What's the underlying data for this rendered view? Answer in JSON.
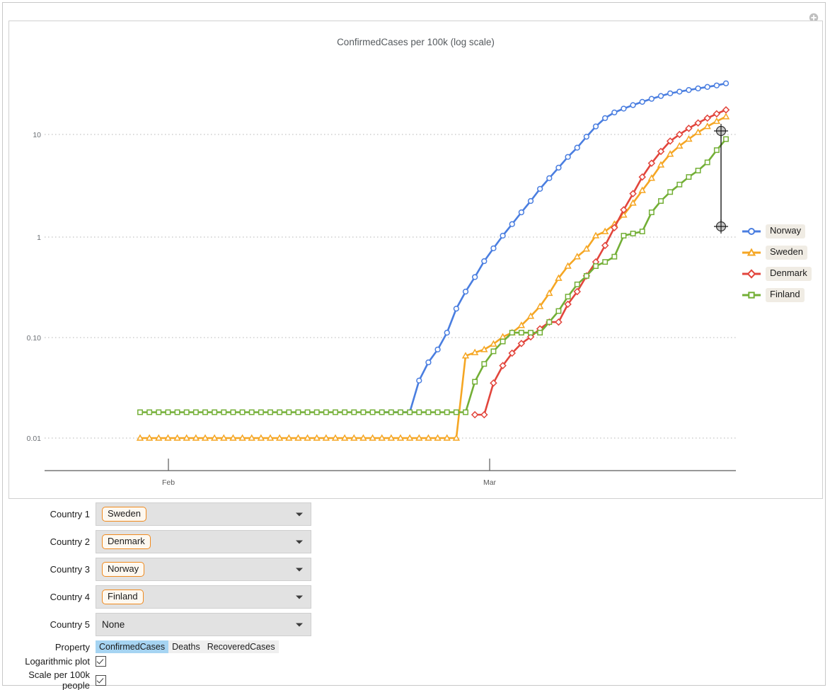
{
  "window": {
    "add_icon": "add-circle-icon"
  },
  "chart": {
    "title": "ConfirmedCases per 100k (log scale)",
    "legend": [
      {
        "label": "Norway",
        "color": "#4a7ee0",
        "marker": "circle"
      },
      {
        "label": "Sweden",
        "color": "#f5a623",
        "marker": "triangle"
      },
      {
        "label": "Denmark",
        "color": "#e2453c",
        "marker": "diamond"
      },
      {
        "label": "Finland",
        "color": "#73af36",
        "marker": "square"
      }
    ]
  },
  "chart_data": {
    "type": "line",
    "title": "ConfirmedCases per 100k (log scale)",
    "xlabel": "",
    "ylabel": "ConfirmedCases per 100k",
    "log_y": true,
    "grid": true,
    "legend_position": "right",
    "ytick_labels": [
      "10",
      "1",
      "0.10",
      "0.01"
    ],
    "ytick_values": [
      10,
      1,
      0.1,
      0.01
    ],
    "ylim": [
      0.008,
      40
    ],
    "xtick_labels": [
      "Feb",
      "Mar"
    ],
    "x": [
      "Jan 22",
      "Jan 23",
      "Jan 24",
      "Jan 25",
      "Jan 26",
      "Jan 27",
      "Jan 28",
      "Jan 29",
      "Jan 30",
      "Jan 31",
      "Feb 01",
      "Feb 02",
      "Feb 03",
      "Feb 04",
      "Feb 05",
      "Feb 06",
      "Feb 07",
      "Feb 08",
      "Feb 09",
      "Feb 10",
      "Feb 11",
      "Feb 12",
      "Feb 13",
      "Feb 14",
      "Feb 15",
      "Feb 16",
      "Feb 17",
      "Feb 18",
      "Feb 19",
      "Feb 20",
      "Feb 21",
      "Feb 22",
      "Feb 23",
      "Feb 24",
      "Feb 25",
      "Feb 26",
      "Feb 27",
      "Feb 28",
      "Feb 29",
      "Mar 01",
      "Mar 02",
      "Mar 03",
      "Mar 04",
      "Mar 05",
      "Mar 06",
      "Mar 07",
      "Mar 08",
      "Mar 09",
      "Mar 10",
      "Mar 11",
      "Mar 12",
      "Mar 13",
      "Mar 14",
      "Mar 15",
      "Mar 16",
      "Mar 17",
      "Mar 18",
      "Mar 19",
      "Mar 20",
      "Mar 21",
      "Mar 22",
      "Mar 23",
      "Mar 24",
      "Mar 25"
    ],
    "series": [
      {
        "name": "Norway",
        "color": "#4a7ee0",
        "marker": "circle",
        "values": [
          null,
          null,
          null,
          null,
          null,
          null,
          null,
          null,
          null,
          null,
          null,
          null,
          null,
          null,
          null,
          null,
          null,
          null,
          null,
          null,
          null,
          null,
          null,
          null,
          null,
          null,
          0.018,
          0.018,
          0.018,
          0.018,
          0.037,
          0.056,
          0.075,
          0.11,
          0.19,
          0.28,
          0.39,
          0.56,
          0.75,
          1.0,
          1.3,
          1.7,
          2.2,
          2.9,
          3.7,
          4.7,
          6.0,
          7.4,
          9.5,
          12.0,
          14.5,
          16.5,
          18.0,
          19.5,
          21.0,
          22.5,
          24.0,
          25.5,
          26.5,
          27.5,
          28.5,
          29.5,
          30.5,
          32.0
        ]
      },
      {
        "name": "Sweden",
        "color": "#f5a623",
        "marker": "triangle",
        "values": [
          0.01,
          0.01,
          0.01,
          0.01,
          0.01,
          0.01,
          0.01,
          0.01,
          0.01,
          0.01,
          0.01,
          0.01,
          0.01,
          0.01,
          0.01,
          0.01,
          0.01,
          0.01,
          0.01,
          0.01,
          0.01,
          0.01,
          0.01,
          0.01,
          0.01,
          0.01,
          0.01,
          0.01,
          0.01,
          0.01,
          0.01,
          0.01,
          0.01,
          0.01,
          0.01,
          0.065,
          0.07,
          0.075,
          0.085,
          0.1,
          0.11,
          0.13,
          0.16,
          0.2,
          0.27,
          0.38,
          0.5,
          0.62,
          0.74,
          1.0,
          1.1,
          1.3,
          1.6,
          2.1,
          2.8,
          3.7,
          5.0,
          6.4,
          7.7,
          9.0,
          10.5,
          12.0,
          13.5,
          15.0
        ]
      },
      {
        "name": "Denmark",
        "color": "#e2453c",
        "marker": "diamond",
        "values": [
          null,
          null,
          null,
          null,
          null,
          null,
          null,
          null,
          null,
          null,
          null,
          null,
          null,
          null,
          null,
          null,
          null,
          null,
          null,
          null,
          null,
          null,
          null,
          null,
          null,
          null,
          null,
          null,
          null,
          null,
          null,
          null,
          null,
          null,
          null,
          null,
          0.017,
          0.017,
          0.035,
          0.052,
          0.069,
          0.086,
          0.1,
          0.12,
          0.14,
          0.14,
          0.21,
          0.28,
          0.4,
          0.55,
          0.8,
          1.2,
          1.8,
          2.6,
          3.8,
          5.2,
          6.8,
          8.6,
          10.0,
          11.5,
          13.0,
          14.5,
          16.0,
          17.5
        ]
      },
      {
        "name": "Finland",
        "color": "#73af36",
        "marker": "square",
        "values": [
          0.018,
          0.018,
          0.018,
          0.018,
          0.018,
          0.018,
          0.018,
          0.018,
          0.018,
          0.018,
          0.018,
          0.018,
          0.018,
          0.018,
          0.018,
          0.018,
          0.018,
          0.018,
          0.018,
          0.018,
          0.018,
          0.018,
          0.018,
          0.018,
          0.018,
          0.018,
          0.018,
          0.018,
          0.018,
          0.018,
          0.018,
          0.018,
          0.018,
          0.018,
          0.018,
          0.018,
          0.036,
          0.054,
          0.072,
          0.09,
          0.11,
          0.11,
          0.11,
          0.11,
          0.14,
          0.18,
          0.25,
          0.33,
          0.4,
          0.5,
          0.55,
          0.62,
          1.0,
          1.05,
          1.1,
          1.7,
          2.2,
          2.7,
          3.2,
          3.8,
          4.4,
          5.3,
          7.0,
          9.0
        ]
      }
    ]
  },
  "controls": {
    "rows": [
      {
        "label": "Country 1",
        "value": "Sweden",
        "styled": true
      },
      {
        "label": "Country 2",
        "value": "Denmark",
        "styled": true
      },
      {
        "label": "Country 3",
        "value": "Norway",
        "styled": true
      },
      {
        "label": "Country 4",
        "value": "Finland",
        "styled": true
      },
      {
        "label": "Country 5",
        "value": "None",
        "styled": false
      }
    ],
    "property": {
      "label": "Property",
      "options": [
        "ConfirmedCases",
        "Deaths",
        "RecoveredCases"
      ],
      "selected": "ConfirmedCases"
    },
    "log_plot": {
      "label": "Logarithmic plot",
      "checked": true
    },
    "per_100k": {
      "label": "Scale per 100k people",
      "checked": true
    }
  }
}
